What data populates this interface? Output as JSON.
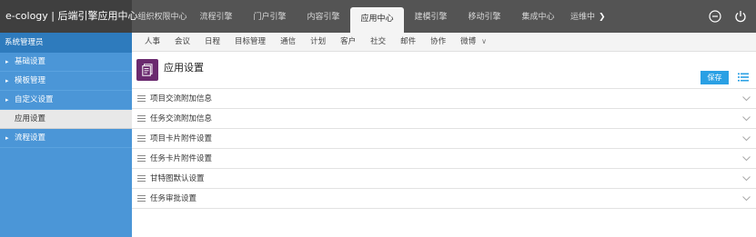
{
  "header": {
    "brand": "e-cology | 后端引擎应用中心",
    "tabs": [
      "组织权限中心",
      "流程引擎",
      "门户引擎",
      "内容引擎",
      "应用中心",
      "建模引擎",
      "移动引擎",
      "集成中心",
      "运维中"
    ],
    "active_tab": "应用中心",
    "icons": [
      "minus-circle-icon",
      "power-icon"
    ]
  },
  "sidebar": {
    "title": "系统管理员",
    "items": [
      {
        "label": "基础设置",
        "has_arrow": true
      },
      {
        "label": "模板管理",
        "has_arrow": true
      },
      {
        "label": "自定义设置",
        "has_arrow": true
      },
      {
        "label": "应用设置",
        "has_arrow": false,
        "selected": true
      },
      {
        "label": "流程设置",
        "has_arrow": true
      }
    ]
  },
  "subnav": {
    "tabs": [
      "人事",
      "会议",
      "日程",
      "目标管理",
      "通信",
      "计划",
      "客户",
      "社交",
      "邮件",
      "协作",
      "微博"
    ],
    "more_icon": "double-chevron-down-icon"
  },
  "page": {
    "title": "应用设置",
    "save_label": "保存",
    "rows": [
      "项目交流附加信息",
      "任务交流附加信息",
      "项目卡片附件设置",
      "任务卡片附件设置",
      "甘特图默认设置",
      "任务审批设置"
    ]
  },
  "colors": {
    "topbar": "#545454",
    "sidebar": "#4b96d7",
    "accent": "#2aa0e4",
    "page_icon": "#6b2a6f"
  }
}
